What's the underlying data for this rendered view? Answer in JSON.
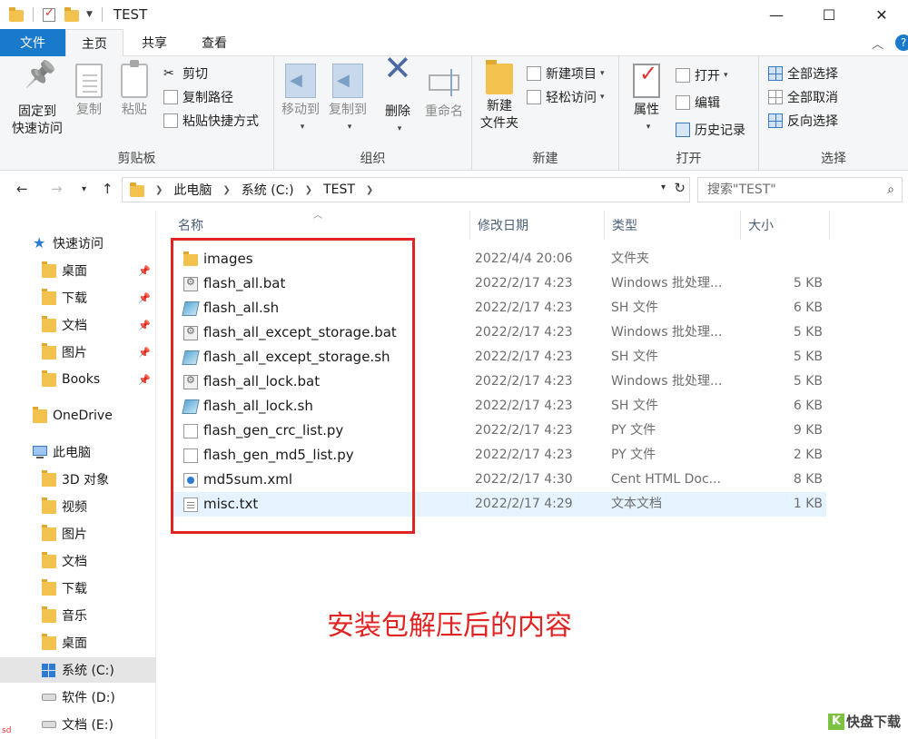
{
  "window": {
    "title": "TEST",
    "controls": {
      "minimize": "—",
      "maximize": "☐",
      "close": "✕"
    }
  },
  "ribbon_tabs": {
    "file": "文件",
    "home": "主页",
    "share": "共享",
    "view": "查看"
  },
  "ribbon": {
    "clipboard": {
      "label": "剪贴板",
      "pin_line1": "固定到",
      "pin_line2": "快速访问",
      "copy": "复制",
      "paste": "粘贴",
      "cut": "剪切",
      "copy_path": "复制路径",
      "paste_shortcut": "粘贴快捷方式"
    },
    "organize": {
      "label": "组织",
      "move_to": "移动到",
      "copy_to": "复制到",
      "delete": "删除",
      "rename": "重命名"
    },
    "new": {
      "label": "新建",
      "new_folder_line1": "新建",
      "new_folder_line2": "文件夹",
      "new_item": "新建项目",
      "easy_access": "轻松访问"
    },
    "open": {
      "label": "打开",
      "properties": "属性",
      "open": "打开",
      "edit": "编辑",
      "history": "历史记录"
    },
    "select": {
      "label": "选择",
      "select_all": "全部选择",
      "select_none": "全部取消",
      "invert": "反向选择"
    }
  },
  "address": {
    "crumbs": [
      "此电脑",
      "系统 (C:)",
      "TEST"
    ],
    "search_placeholder": "搜索\"TEST\""
  },
  "sidebar": {
    "quick_access": "快速访问",
    "quick_items": [
      "桌面",
      "下载",
      "文档",
      "图片",
      "Books"
    ],
    "onedrive": "OneDrive",
    "this_pc": "此电脑",
    "pc_items": [
      "3D 对象",
      "视频",
      "图片",
      "文档",
      "下载",
      "音乐",
      "桌面",
      "系统 (C:)",
      "软件 (D:)",
      "文档 (E:)"
    ]
  },
  "columns": {
    "name": "名称",
    "date": "修改日期",
    "type": "类型",
    "size": "大小"
  },
  "files": [
    {
      "name": "images",
      "date": "2022/4/4 20:06",
      "type": "文件夹",
      "size": "",
      "icon": "folder"
    },
    {
      "name": "flash_all.bat",
      "date": "2022/2/17 4:23",
      "type": "Windows 批处理...",
      "size": "5 KB",
      "icon": "bat"
    },
    {
      "name": "flash_all.sh",
      "date": "2022/2/17 4:23",
      "type": "SH 文件",
      "size": "6 KB",
      "icon": "sh"
    },
    {
      "name": "flash_all_except_storage.bat",
      "date": "2022/2/17 4:23",
      "type": "Windows 批处理...",
      "size": "5 KB",
      "icon": "bat"
    },
    {
      "name": "flash_all_except_storage.sh",
      "date": "2022/2/17 4:23",
      "type": "SH 文件",
      "size": "5 KB",
      "icon": "sh"
    },
    {
      "name": "flash_all_lock.bat",
      "date": "2022/2/17 4:23",
      "type": "Windows 批处理...",
      "size": "5 KB",
      "icon": "bat"
    },
    {
      "name": "flash_all_lock.sh",
      "date": "2022/2/17 4:23",
      "type": "SH 文件",
      "size": "6 KB",
      "icon": "sh"
    },
    {
      "name": "flash_gen_crc_list.py",
      "date": "2022/2/17 4:23",
      "type": "PY 文件",
      "size": "9 KB",
      "icon": "py"
    },
    {
      "name": "flash_gen_md5_list.py",
      "date": "2022/2/17 4:23",
      "type": "PY 文件",
      "size": "2 KB",
      "icon": "py"
    },
    {
      "name": "md5sum.xml",
      "date": "2022/2/17 4:30",
      "type": "Cent HTML Doc...",
      "size": "8 KB",
      "icon": "xml"
    },
    {
      "name": "misc.txt",
      "date": "2022/2/17 4:29",
      "type": "文本文档",
      "size": "1 KB",
      "icon": "txt"
    }
  ],
  "annotation": "安装包解压后的内容",
  "watermark": {
    "k": "K",
    "text": "快盘下载"
  },
  "corner_text": "sd",
  "colors": {
    "accent": "#1979ca",
    "annotation_red": "#e02424",
    "selected_row": "#e5f3ff"
  }
}
